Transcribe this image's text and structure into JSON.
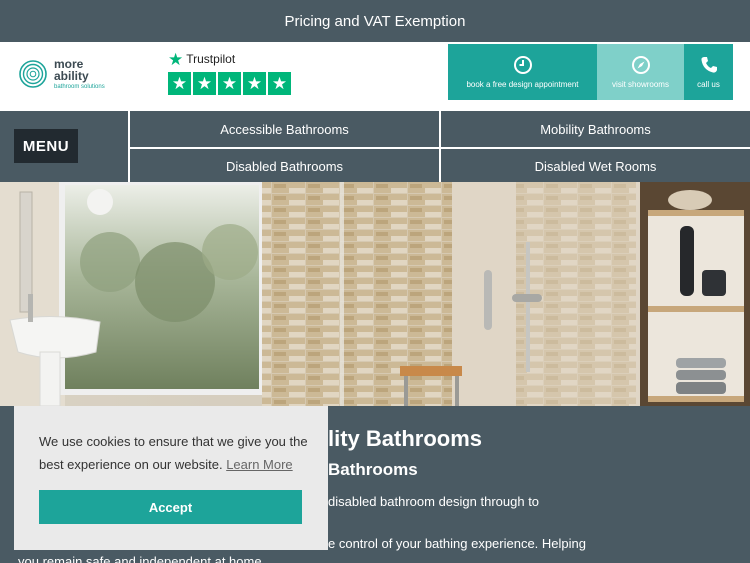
{
  "topbar": {
    "text": "Pricing and VAT Exemption"
  },
  "logo": {
    "line1": "more",
    "line2": "ability",
    "line3": "bathroom solutions"
  },
  "trustpilot": {
    "brand": "Trustpilot",
    "rating": 5
  },
  "cta": [
    {
      "label": "book a free design appointment",
      "icon": "clock-icon"
    },
    {
      "label": "visit showrooms",
      "icon": "compass-icon"
    },
    {
      "label": "call us",
      "icon": "phone-icon"
    }
  ],
  "nav": {
    "menu_label": "MENU",
    "items": [
      "Accessible Bathrooms",
      "Mobility Bathrooms",
      "Disabled Bathrooms",
      "Disabled Wet Rooms"
    ]
  },
  "content": {
    "heading_fragment": "lity Bathrooms",
    "subheading_fragment": "Bathrooms",
    "para1_fragment": "disabled bathroom design through to",
    "para2_fragment": "e control of your bathing experience. Helping",
    "para3_fragment": "you remain safe and independent at home."
  },
  "cookie": {
    "text": "We use cookies to ensure that we give you the best experience on our website.",
    "link": "Learn More",
    "accept": "Accept"
  },
  "colors": {
    "accent": "#1da49a",
    "accent_light": "#7fd0c9",
    "slate": "#4a5a63",
    "trustpilot": "#00b67a"
  }
}
